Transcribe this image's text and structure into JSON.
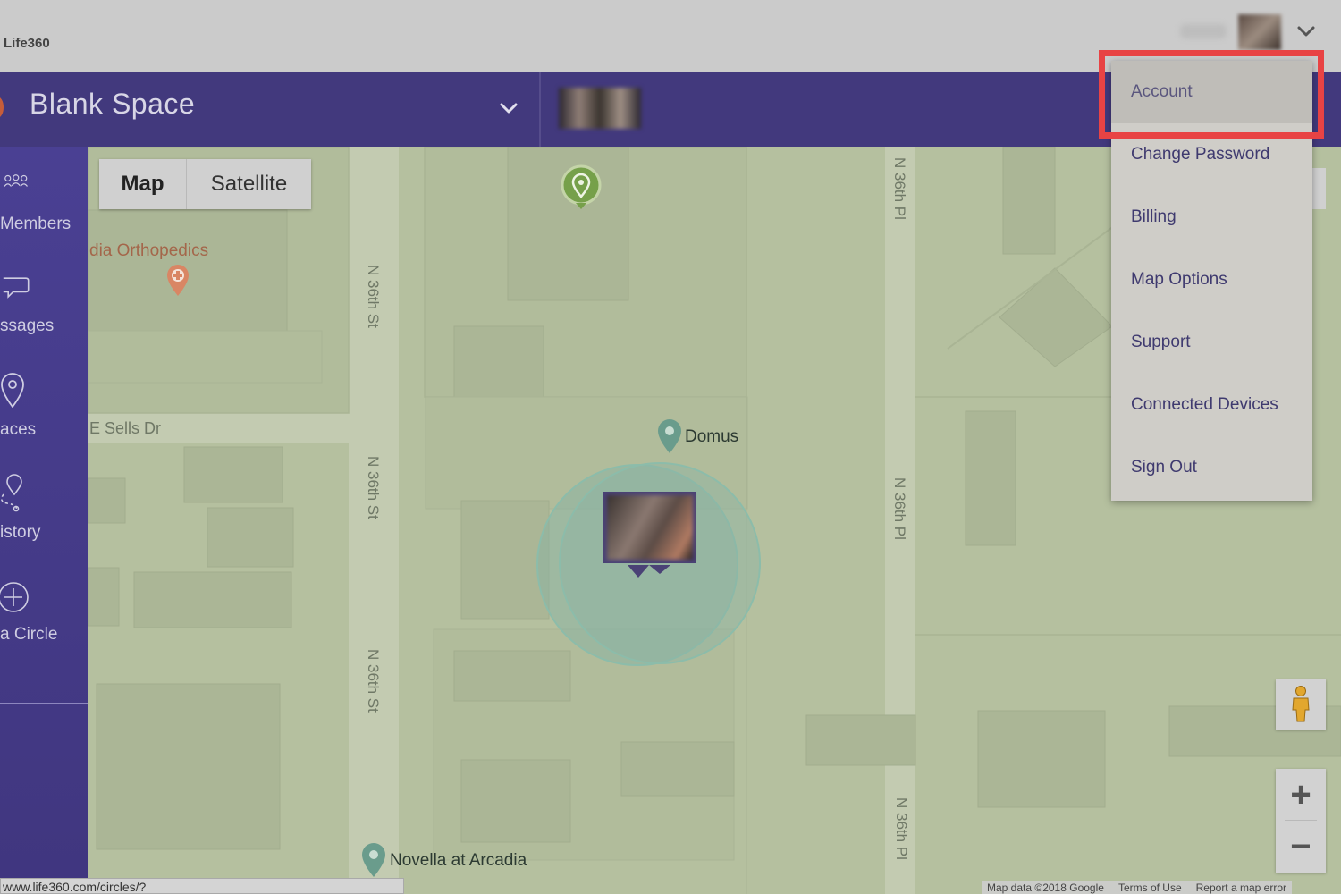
{
  "app": {
    "name": "Life360"
  },
  "header": {
    "circle_name": "Blank Space"
  },
  "sidebar": {
    "items": [
      {
        "label": "Members",
        "icon": "members-icon"
      },
      {
        "label": "ssages",
        "icon": "messages-icon"
      },
      {
        "label": "aces",
        "icon": "places-icon"
      },
      {
        "label": "istory",
        "icon": "history-icon"
      },
      {
        "label": "a Circle",
        "icon": "add-circle-icon"
      }
    ]
  },
  "map": {
    "type_buttons": {
      "map": "Map",
      "satellite": "Satellite"
    },
    "labels": {
      "poi_orthopedics": "dia Orthopedics",
      "street_sells": "E Sells Dr",
      "poi_domus": "Domus",
      "poi_novella": "Novella at Arcadia",
      "street_36th_st": "N 36th St",
      "street_36th_pl": "N 36th Pl"
    },
    "attribution": [
      "Map data ©2018 Google",
      "Terms of Use",
      "Report a map error"
    ],
    "zoom": {
      "in": "+",
      "out": "−"
    }
  },
  "status_bar": {
    "url": "www.life360.com/circles/?"
  },
  "user_menu": {
    "items": [
      {
        "label": "Account",
        "highlighted": true
      },
      {
        "label": "Change Password"
      },
      {
        "label": "Billing"
      },
      {
        "label": "Map Options"
      },
      {
        "label": "Support"
      },
      {
        "label": "Connected Devices"
      },
      {
        "label": "Sign Out"
      }
    ]
  },
  "colors": {
    "header": "#42397d",
    "sidebar": "#4a4093",
    "map": "#b5c09f",
    "highlight": "#e84344"
  }
}
